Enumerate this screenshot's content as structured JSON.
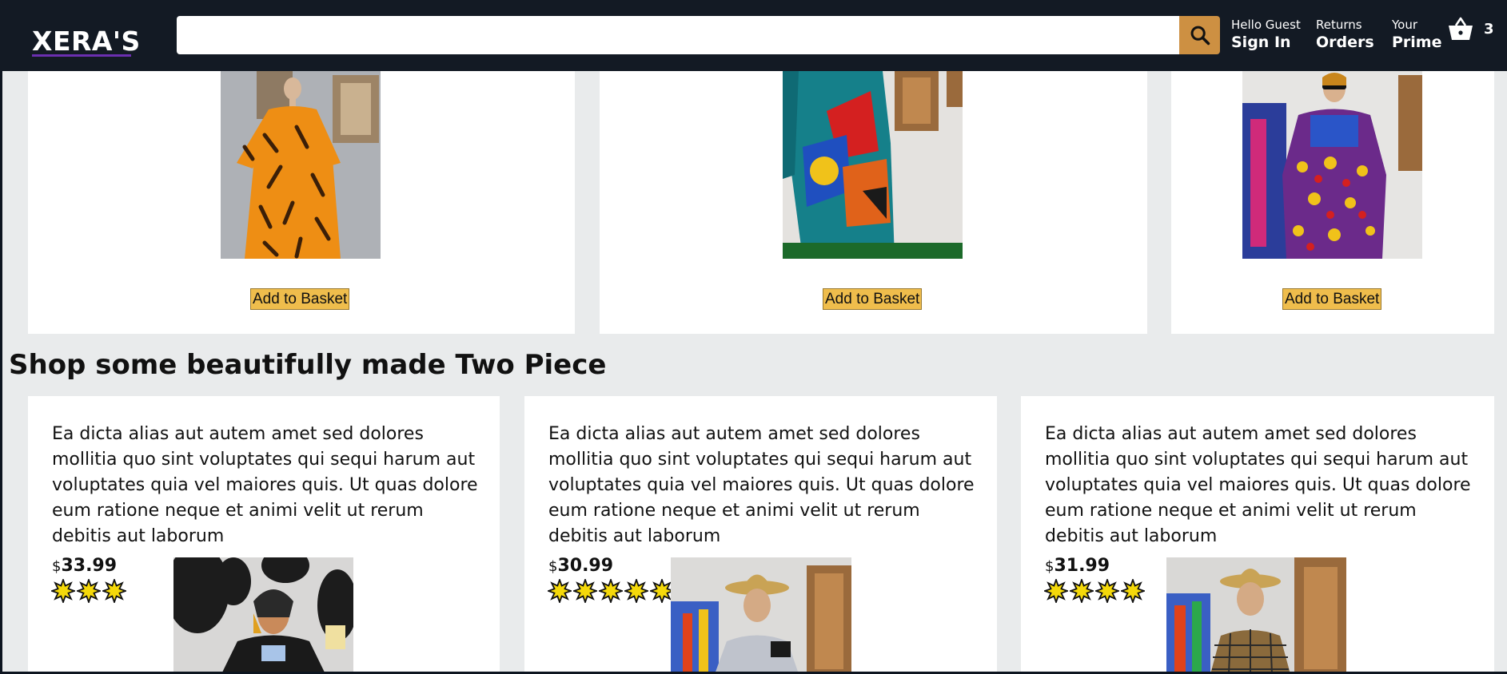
{
  "header": {
    "logo": "XERA'S",
    "search": {
      "value": "",
      "placeholder": ""
    },
    "nav": [
      {
        "line1": "Hello Guest",
        "line2": "Sign In"
      },
      {
        "line1": "Returns",
        "line2": "Orders"
      },
      {
        "line1": "Your",
        "line2": "Prime"
      }
    ],
    "basket_count": "3"
  },
  "top_products": [
    {
      "image": "orange-print-dress",
      "button": "Add to Basket"
    },
    {
      "image": "teal-patchwork-dress",
      "button": "Add to Basket"
    },
    {
      "image": "multicolor-print-dress",
      "button": "Add to Basket"
    }
  ],
  "section_title": "Shop some beautifully made Two Piece",
  "two_piece_products": [
    {
      "description": "Ea dicta alias aut autem amet sed dolores mollitia quo sint voluptates qui sequi harum aut voluptates quia vel maiores quis. Ut quas dolore eum ratione neque et animi velit ut rerum debitis aut laborum",
      "currency": "$",
      "price": "33.99",
      "rating": 3,
      "image": "two-piece-black-white"
    },
    {
      "description": "Ea dicta alias aut autem amet sed dolores mollitia quo sint voluptates qui sequi harum aut voluptates quia vel maiores quis. Ut quas dolore eum ratione neque et animi velit ut rerum debitis aut laborum",
      "currency": "$",
      "price": "30.99",
      "rating": 5,
      "image": "two-piece-hat-white-shirt"
    },
    {
      "description": "Ea dicta alias aut autem amet sed dolores mollitia quo sint voluptates qui sequi harum aut voluptates quia vel maiores quis. Ut quas dolore eum ratione neque et animi velit ut rerum debitis aut laborum",
      "currency": "$",
      "price": "31.99",
      "rating": 4,
      "image": "two-piece-hat-plaid"
    }
  ],
  "colors": {
    "header_bg": "#131a24",
    "search_button": "#cd9042",
    "add_button": "#efbd4c",
    "page_bg": "#e9ebec",
    "star_fill": "#f5d90a"
  }
}
